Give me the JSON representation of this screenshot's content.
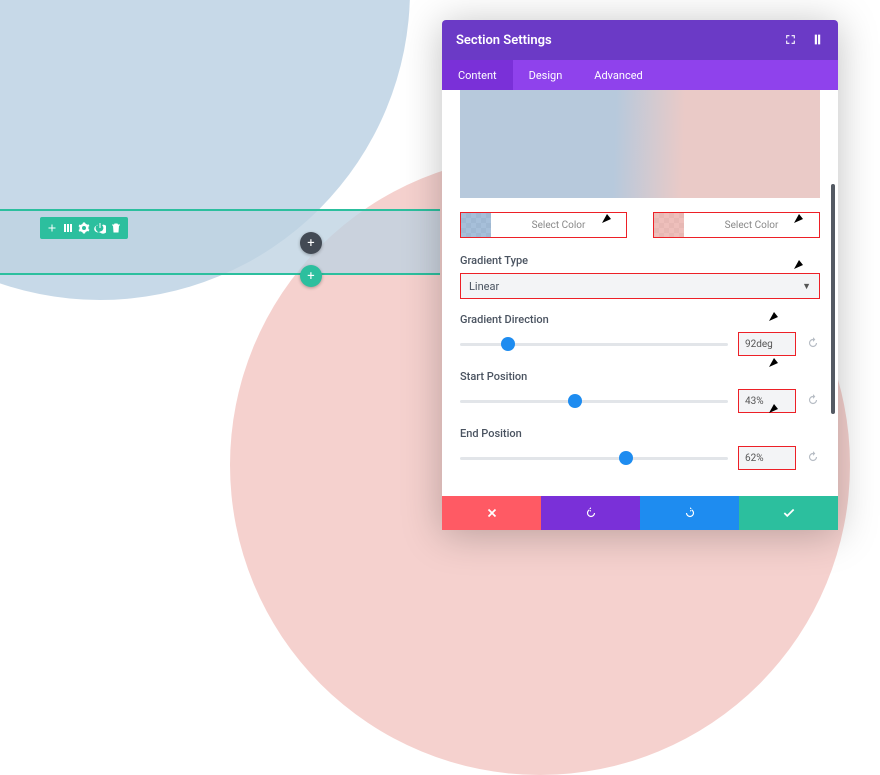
{
  "modal": {
    "title": "Section Settings",
    "tabs": [
      {
        "label": "Content",
        "active": true
      },
      {
        "label": "Design",
        "active": false
      },
      {
        "label": "Advanced",
        "active": false
      }
    ]
  },
  "color_picker": {
    "left_label": "Select Color",
    "right_label": "Select Color"
  },
  "gradient_type": {
    "label": "Gradient Type",
    "value": "Linear"
  },
  "gradient_direction": {
    "label": "Gradient Direction",
    "value": "92deg",
    "slider_pct": 18
  },
  "start_position": {
    "label": "Start Position",
    "value": "43%",
    "slider_pct": 43
  },
  "end_position": {
    "label": "End Position",
    "value": "62%",
    "slider_pct": 62
  },
  "icons": {
    "plus": "+"
  }
}
